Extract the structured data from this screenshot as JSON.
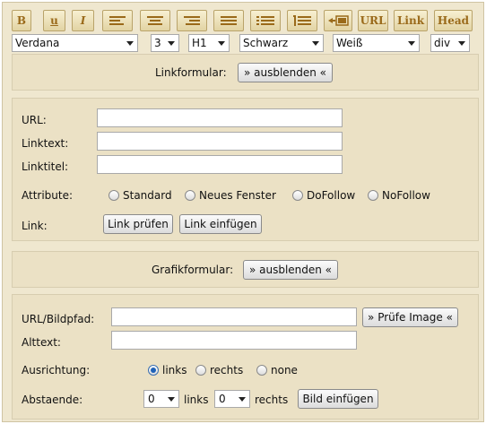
{
  "toolbar": {
    "bold": "B",
    "underline": "u",
    "italic": "I",
    "url": "URL",
    "link": "Link",
    "head": "Head"
  },
  "selects": {
    "font": "Verdana",
    "size": "3",
    "heading": "H1",
    "text_color": "Schwarz",
    "bg_color": "Weiß",
    "block": "div"
  },
  "link_section": {
    "title": "Linkformular:",
    "toggle": "» ausblenden «",
    "url_label": "URL:",
    "url_value": "",
    "linktext_label": "Linktext:",
    "linktext_value": "",
    "linktitel_label": "Linktitel:",
    "linktitel_value": "",
    "attr_label": "Attribute:",
    "attr_options": [
      "Standard",
      "Neues Fenster",
      "DoFollow",
      "NoFollow"
    ],
    "link_label": "Link:",
    "check_button": "Link prüfen",
    "insert_button": "Link einfügen"
  },
  "image_section": {
    "title": "Grafikformular:",
    "toggle": "» ausblenden «",
    "url_label": "URL/Bildpfad:",
    "url_value": "",
    "check_button": "» Prüfe Image «",
    "alt_label": "Alttext:",
    "alt_value": "",
    "align_label": "Ausrichtung:",
    "align_options": [
      "links",
      "rechts",
      "none"
    ],
    "align_selected": "links",
    "spacing_label": "Abstaende:",
    "left_value": "0",
    "left_label": "links",
    "right_value": "0",
    "right_label": "rechts",
    "insert_button": "Bild einfügen"
  },
  "colors": {
    "panel_bg": "#ebe1c5",
    "frame_bg": "#efe7cf",
    "toolbar_icon": "#9a6a1a"
  }
}
